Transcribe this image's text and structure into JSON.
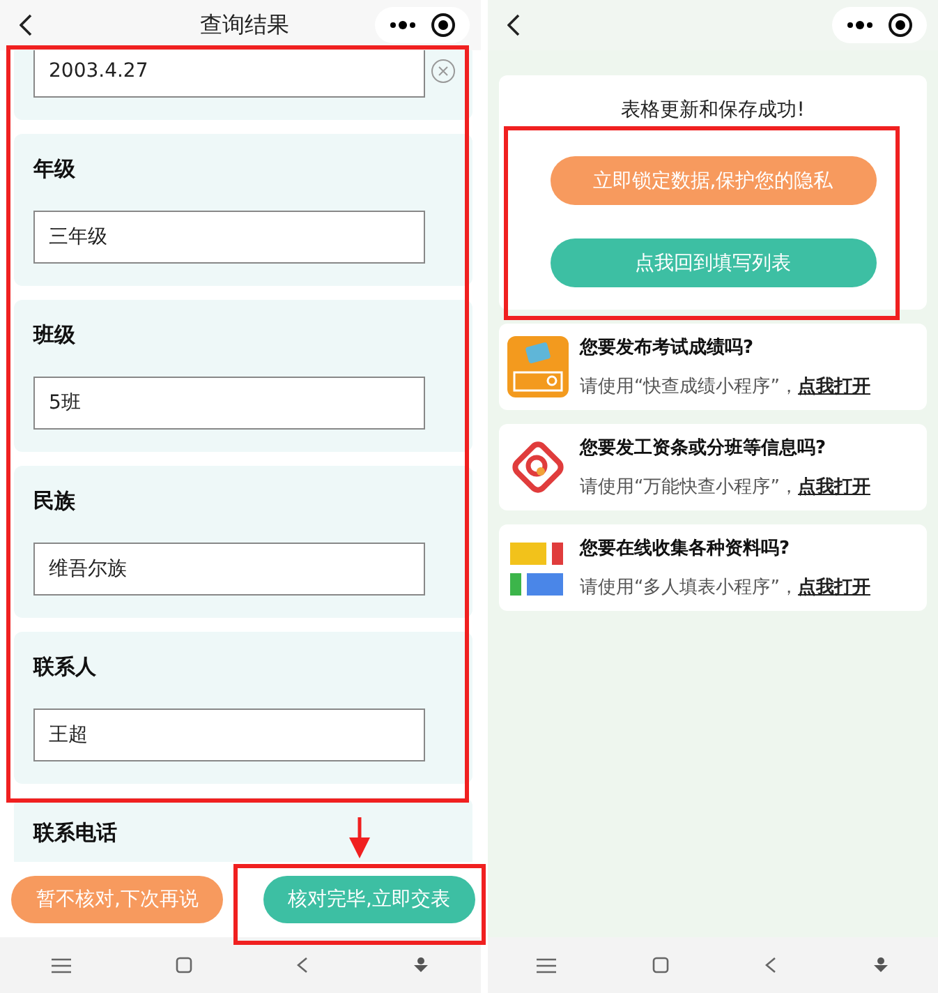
{
  "left": {
    "title": "查询结果",
    "fields": [
      {
        "value": "2003.4.27",
        "clear_button": true
      },
      {
        "label": "年级",
        "value": "三年级",
        "clear_button": false
      },
      {
        "label": "班级",
        "value": "5班",
        "clear_button": false
      },
      {
        "label": "民族",
        "value": "维吾尔族",
        "clear_button": false
      },
      {
        "label": "联系人",
        "value": "王超",
        "clear_button": false
      },
      {
        "label": "联系电话",
        "clear_button": false
      }
    ],
    "buttons": [
      {
        "label": "暂不核对,下次再说",
        "kind": "secondary"
      },
      {
        "label": "核对完毕,立即交表",
        "kind": "primary"
      }
    ]
  },
  "right": {
    "message": "表格更新和保存成功!",
    "buttons": [
      {
        "label": "立即锁定数据,保护您的隐私",
        "kind": "secondary"
      },
      {
        "label": "点我回到填写列表",
        "kind": "primary"
      }
    ],
    "promos": [
      {
        "kind": "grades",
        "title": "您要发布考试成绩吗?",
        "text": "请使用“快查成绩小程序”，",
        "link": "点我打开"
      },
      {
        "kind": "target",
        "title": "您要发工资条或分班等信息吗?",
        "text": "请使用“万能快查小程序”，",
        "link": "点我打开"
      },
      {
        "kind": "blocks",
        "title": "您要在线收集各种资料吗?",
        "text": "请使用“多人填表小程序”，",
        "link": "点我打开"
      }
    ]
  }
}
